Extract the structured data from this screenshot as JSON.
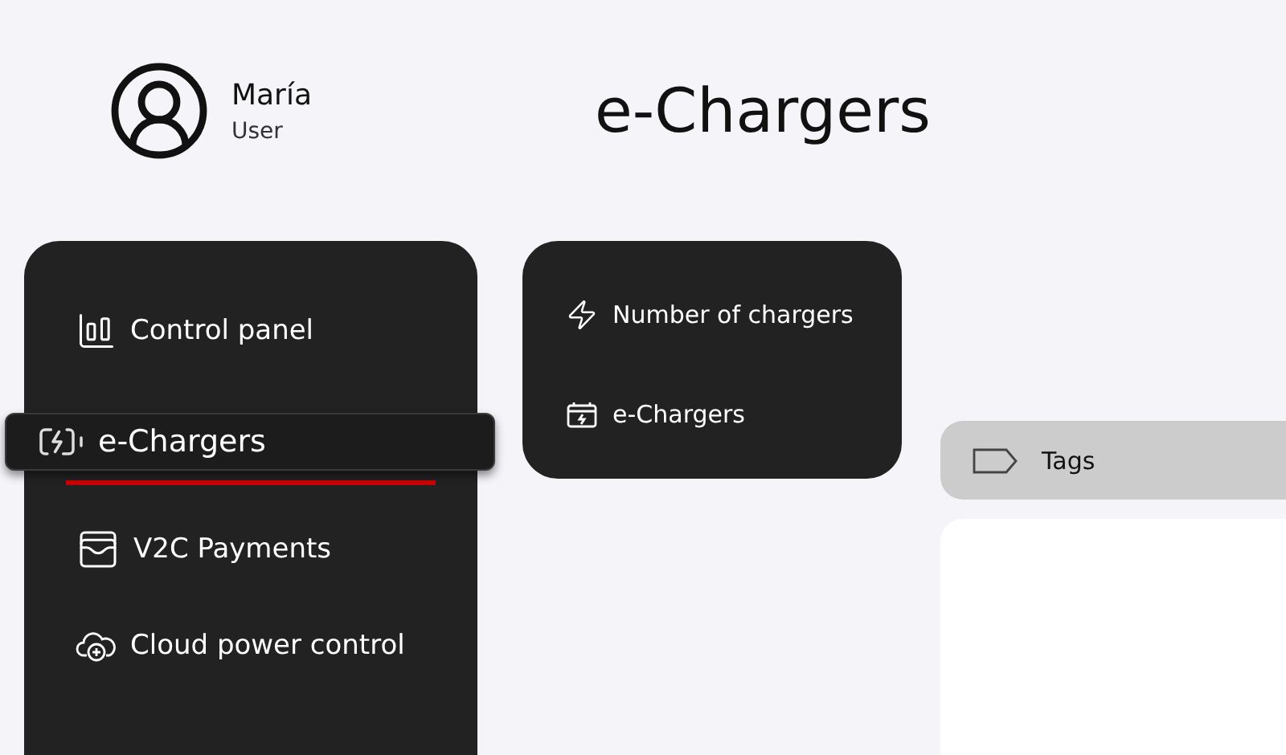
{
  "user": {
    "name": "María",
    "role": "User"
  },
  "page_title": "e-Chargers",
  "sidebar": {
    "items": [
      {
        "kind": "chart",
        "label": "Control panel",
        "selected": false
      },
      {
        "kind": "battery",
        "label": "e-Chargers",
        "selected": true
      },
      {
        "kind": "wallet",
        "label": "V2C Payments",
        "selected": false
      },
      {
        "kind": "cloud",
        "label": "Cloud power control",
        "selected": false
      }
    ]
  },
  "submenu": {
    "items": [
      {
        "kind": "bolt",
        "label": "Number of chargers"
      },
      {
        "kind": "charger",
        "label": "e-Chargers"
      }
    ]
  },
  "tags_bar": {
    "label": "Tags"
  }
}
